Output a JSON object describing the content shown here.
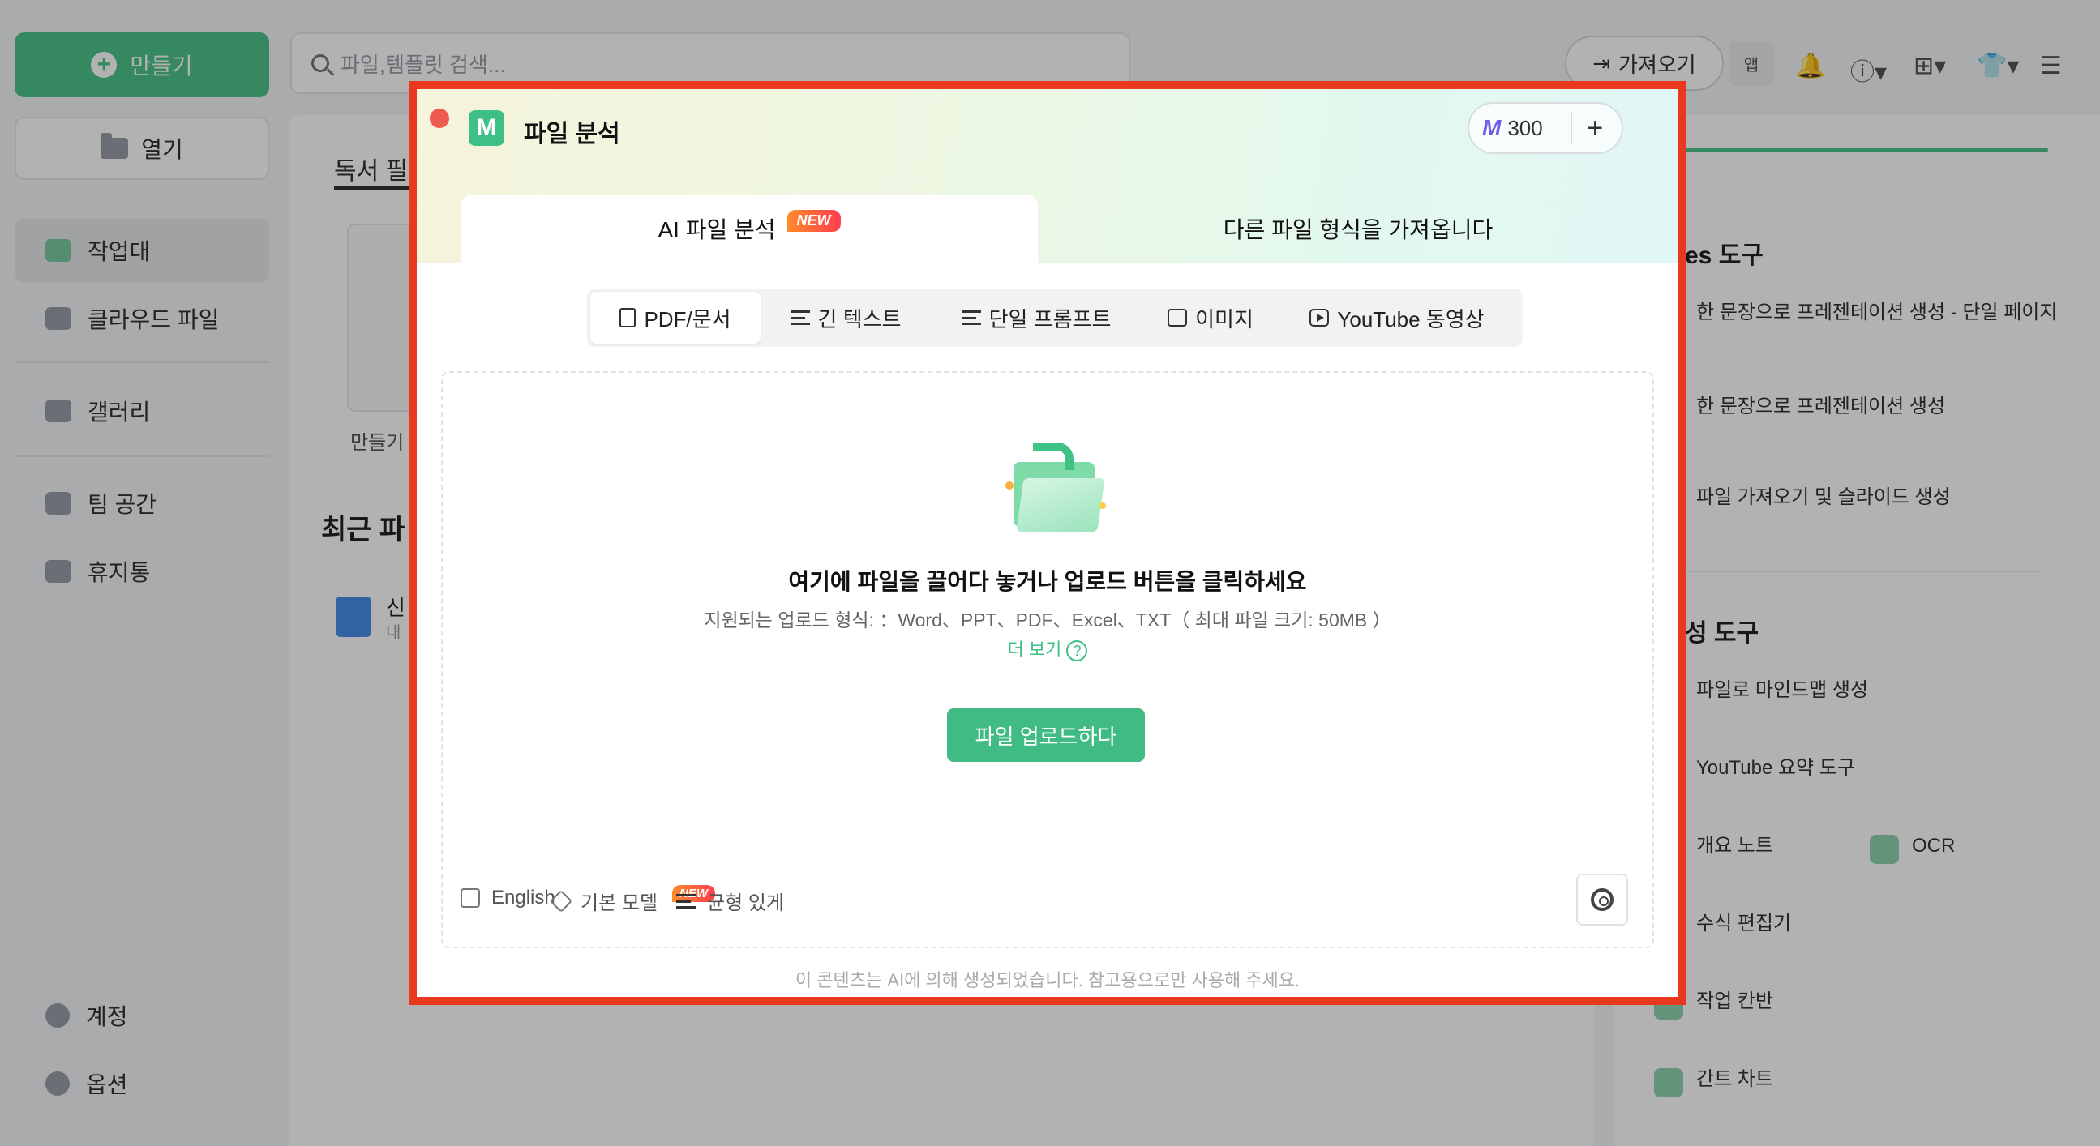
{
  "sidebar": {
    "create_label": "만들기",
    "open_label": "열기",
    "items": [
      {
        "label": "작업대"
      },
      {
        "label": "클라우드 파일"
      },
      {
        "label": "갤러리"
      },
      {
        "label": "팀 공간"
      },
      {
        "label": "휴지통"
      }
    ],
    "bottom": [
      {
        "label": "계정"
      },
      {
        "label": "옵션"
      }
    ]
  },
  "topbar": {
    "search_placeholder": "파일,템플릿 검색...",
    "import_label": "가져오기",
    "app_label": "앱"
  },
  "main": {
    "tab": "독서 필",
    "blank_label": "만들기",
    "recent_title": "최근 파",
    "recent_item": {
      "name": "신",
      "sub": "내"
    }
  },
  "right_panel": {
    "section1_title": "es 도구",
    "section1_items": [
      "한 문장으로 프레젠테이션 생성 - 단일 페이지",
      "한 문장으로 프레젠테이션 생성",
      "파일 가져오기 및 슬라이드 생성"
    ],
    "section2_title": "성 도구",
    "section2_items": [
      "파일로 마인드맵 생성",
      "YouTube 요약 도구",
      "개요 노트",
      "수식 편집기",
      "작업 칸반",
      "간트 차트"
    ],
    "ocr_label": "OCR"
  },
  "dialog": {
    "title": "파일 분석",
    "credits": "300",
    "tabs": [
      {
        "label": "AI 파일 분석",
        "badge": "NEW"
      },
      {
        "label": "다른 파일 형식을 가져옵니다"
      }
    ],
    "subtabs": [
      {
        "label": "PDF/문서"
      },
      {
        "label": "긴 텍스트"
      },
      {
        "label": "단일 프롬프트"
      },
      {
        "label": "이미지"
      },
      {
        "label": "YouTube 동영상"
      }
    ],
    "dropzone": {
      "title": "여기에 파일을 끌어다 놓거나 업로드 버튼을 클릭하세요",
      "formats": "지원되는 업로드 형식: ：Word、PPT、PDF、Excel、TXT（ 최대 파일 크기: 50MB ）",
      "more": "더 보기",
      "upload_label": "파일 업로드하다"
    },
    "options": {
      "language": "English",
      "model": "기본 모델",
      "model_badge": "NEW",
      "style": "균형 있게"
    },
    "disclaimer": "이 콘텐츠는 AI에 의해 생성되었습니다. 참고용으로만 사용해 주세요."
  },
  "colors": {
    "accent": "#3fbb83",
    "highlight_border": "#e8391f",
    "badge": "#ff4f3e"
  }
}
